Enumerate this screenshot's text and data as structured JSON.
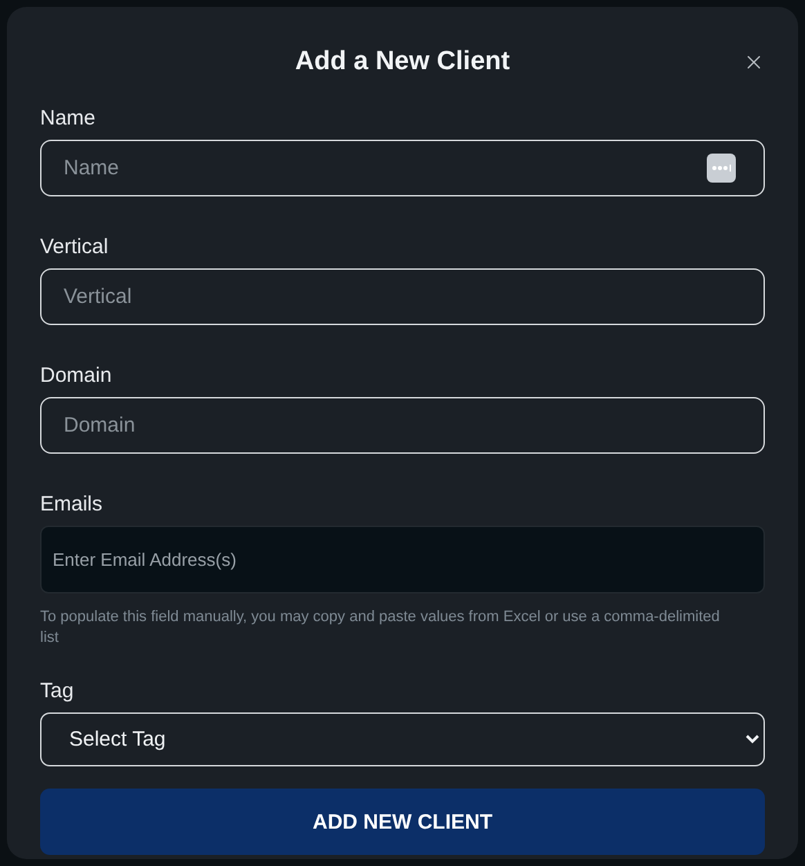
{
  "dialog": {
    "title": "Add a New Client"
  },
  "fields": [
    {
      "kind": "text",
      "label": "Name",
      "placeholder": "Name",
      "autofill": true
    },
    {
      "kind": "text",
      "label": "Vertical",
      "placeholder": "Vertical"
    },
    {
      "kind": "text",
      "label": "Domain",
      "placeholder": "Domain"
    },
    {
      "kind": "emails",
      "label": "Emails",
      "placeholder": "Enter Email Address(s)",
      "help": "To populate this field manually, you may copy and paste values from Excel or use a comma-delimited list"
    },
    {
      "kind": "select",
      "label": "Tag",
      "value": "Select Tag"
    }
  ],
  "submit": "ADD NEW CLIENT"
}
